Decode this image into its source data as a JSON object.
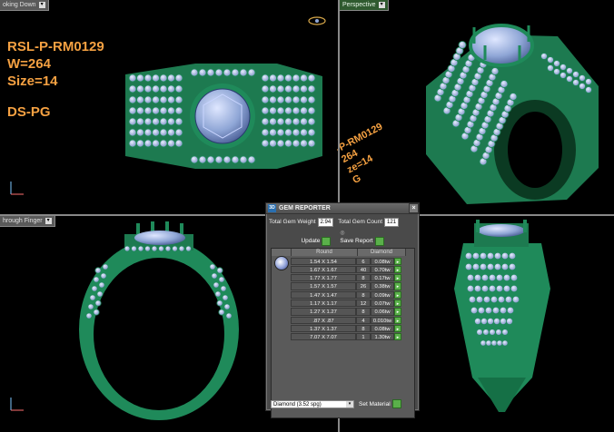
{
  "viewports": {
    "top_left": {
      "label": "oking Down"
    },
    "top_right": {
      "label": "Perspective"
    },
    "bottom_left": {
      "label": "hrough Finger"
    },
    "bottom_right": {
      "label": ""
    }
  },
  "ring_info": {
    "line1": "RSL-P-RM0129",
    "line2": "W=264",
    "line3": "Size=14",
    "line4": "DS-PG"
  },
  "rotated_info": {
    "line1": "-P-RM0129",
    "line2": "264",
    "line3": "ze=14",
    "line4": "G"
  },
  "colors": {
    "metal": "#1f8a5a",
    "gem": "#8fa6d6",
    "text_accent": "#f5a142"
  },
  "gem_reporter": {
    "title": "GEM REPORTER",
    "total_weight_label": "Total Gem Weight",
    "total_weight_value": "2.94",
    "total_count_label": "Total Gem Count",
    "total_count_value": "121",
    "update_label": "Update",
    "save_report_label": "Save Report",
    "col_shape": "Round",
    "col_material": "Diamond",
    "rows": [
      {
        "size": "1.54 X 1.54",
        "count": "6",
        "weight": "0.08tw"
      },
      {
        "size": "1.67 X 1.67",
        "count": "40",
        "weight": "0.70tw"
      },
      {
        "size": "1.77 X 1.77",
        "count": "8",
        "weight": "0.17tw"
      },
      {
        "size": "1.57 X 1.57",
        "count": "26",
        "weight": "0.38tw"
      },
      {
        "size": "1.47 X 1.47",
        "count": "8",
        "weight": "0.09tw"
      },
      {
        "size": "1.17 X 1.17",
        "count": "12",
        "weight": "0.07tw"
      },
      {
        "size": "1.27 X 1.27",
        "count": "8",
        "weight": "0.06tw"
      },
      {
        "size": ".87 X .87",
        "count": "4",
        "weight": "0.010tw"
      },
      {
        "size": "1.37 X 1.37",
        "count": "8",
        "weight": "0.08tw"
      },
      {
        "size": "7.07 X 7.07",
        "count": "1",
        "weight": "1.30tw"
      }
    ],
    "material_select": "Diamond   (3.52 spg)",
    "set_material_label": "Set Material"
  }
}
